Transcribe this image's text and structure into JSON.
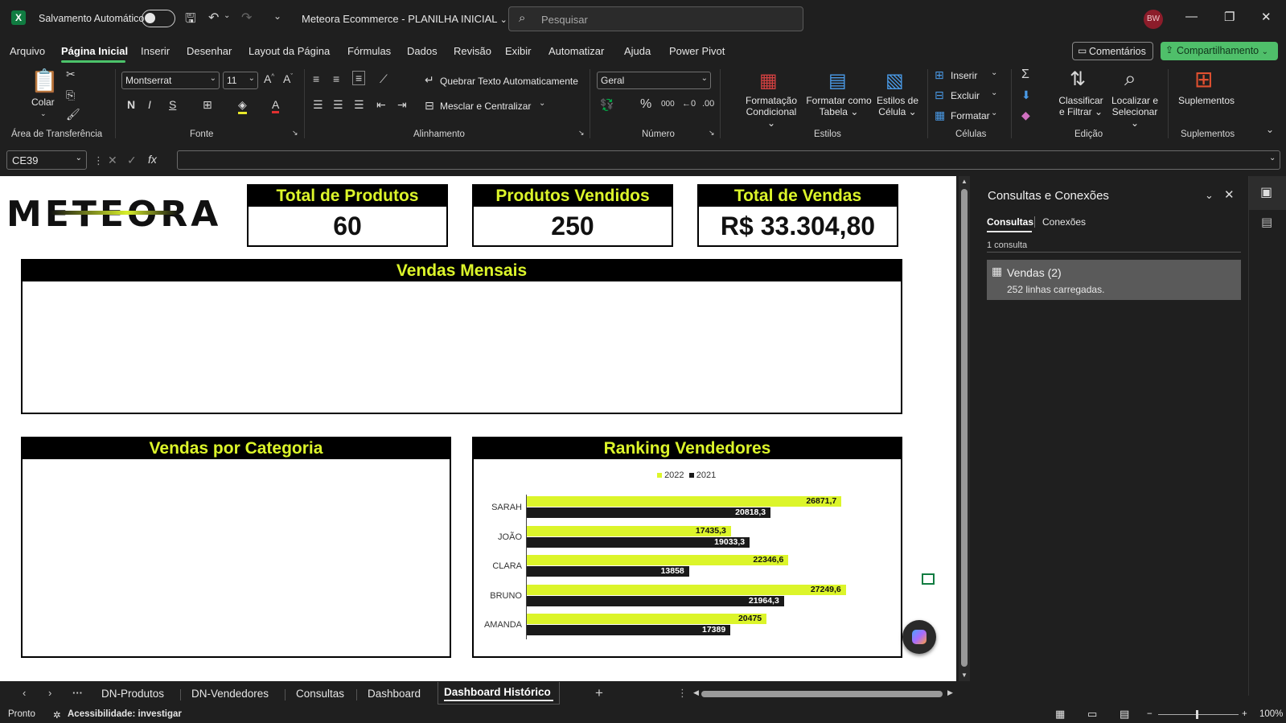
{
  "title_bar": {
    "autosave_label": "Salvamento Automático",
    "doc_title": "Meteora Ecommerce - PLANILHA INICIAL",
    "search_placeholder": "Pesquisar",
    "user_initials": "BW"
  },
  "menu": {
    "items": [
      "Arquivo",
      "Página Inicial",
      "Inserir",
      "Desenhar",
      "Layout da Página",
      "Fórmulas",
      "Dados",
      "Revisão",
      "Exibir",
      "Automatizar",
      "Ajuda",
      "Power Pivot"
    ],
    "active": "Página Inicial",
    "comments_label": "Comentários",
    "share_label": "Compartilhamento"
  },
  "ribbon": {
    "clipboard": {
      "paste_label": "Colar",
      "group_label": "Área de Transferência"
    },
    "font": {
      "font_name": "Montserrat",
      "font_size": "11",
      "group_label": "Fonte"
    },
    "alignment": {
      "wrap_label": "Quebrar Texto Automaticamente",
      "merge_label": "Mesclar e Centralizar",
      "group_label": "Alinhamento"
    },
    "number": {
      "format": "Geral",
      "group_label": "Número"
    },
    "styles": {
      "conditional_label_1": "Formatação",
      "conditional_label_2": "Condicional",
      "table_label_1": "Formatar como",
      "table_label_2": "Tabela",
      "cell_styles_1": "Estilos de",
      "cell_styles_2": "Célula",
      "group_label": "Estilos"
    },
    "cells": {
      "insert": "Inserir",
      "delete": "Excluir",
      "format": "Formatar",
      "group_label": "Células"
    },
    "editing": {
      "sort_1": "Classificar",
      "sort_2": "e Filtrar",
      "find_1": "Localizar e",
      "find_2": "Selecionar",
      "group_label": "Edição"
    },
    "addins": {
      "label": "Suplementos",
      "group_label": "Suplementos"
    }
  },
  "formula_bar": {
    "name_box": "CE39",
    "fx": "fx",
    "formula": ""
  },
  "dashboard": {
    "logo": "METEORA",
    "kpis": [
      {
        "title": "Total de Produtos",
        "value": "60"
      },
      {
        "title": "Produtos Vendidos",
        "value": "250"
      },
      {
        "title": "Total de Vendas",
        "value": "R$ 33.304,80"
      }
    ],
    "monthly_title": "Vendas Mensais",
    "category_title": "Vendas por Categoria",
    "ranking_title": "Ranking Vendedores"
  },
  "chart_data": {
    "type": "bar",
    "orientation": "horizontal",
    "categories": [
      "SARAH",
      "JOÃO",
      "CLARA",
      "BRUNO",
      "AMANDA"
    ],
    "series": [
      {
        "name": "2022",
        "values": [
          26871.7,
          17435.3,
          22346.6,
          27249.6,
          20475
        ],
        "color": "#dcf52a"
      },
      {
        "name": "2021",
        "values": [
          20818.3,
          19033.3,
          13858,
          21964.3,
          17389
        ],
        "color": "#1a1a1a"
      }
    ],
    "value_labels_2022": [
      "26871,7",
      "17435,3",
      "22346,6",
      "27249,6",
      "20475"
    ],
    "value_labels_2021": [
      "20818,3",
      "19033,3",
      "13858",
      "21964,3",
      "17389"
    ],
    "legend_position": "top",
    "xlim": [
      0,
      28500
    ]
  },
  "pane": {
    "title": "Consultas e Conexões",
    "tabs": [
      "Consultas",
      "Conexões"
    ],
    "active_tab": "Consultas",
    "count": "1 consulta",
    "query_name": "Vendas (2)",
    "query_status": "252 linhas carregadas."
  },
  "sheet_tabs": {
    "tabs": [
      "DN-Produtos",
      "DN-Vendedores",
      "Consultas",
      "Dashboard",
      "Dashboard Histórico"
    ],
    "active": "Dashboard Histórico"
  },
  "status_bar": {
    "ready": "Pronto",
    "accessibility": "Acessibilidade: investigar",
    "zoom": "100%"
  }
}
